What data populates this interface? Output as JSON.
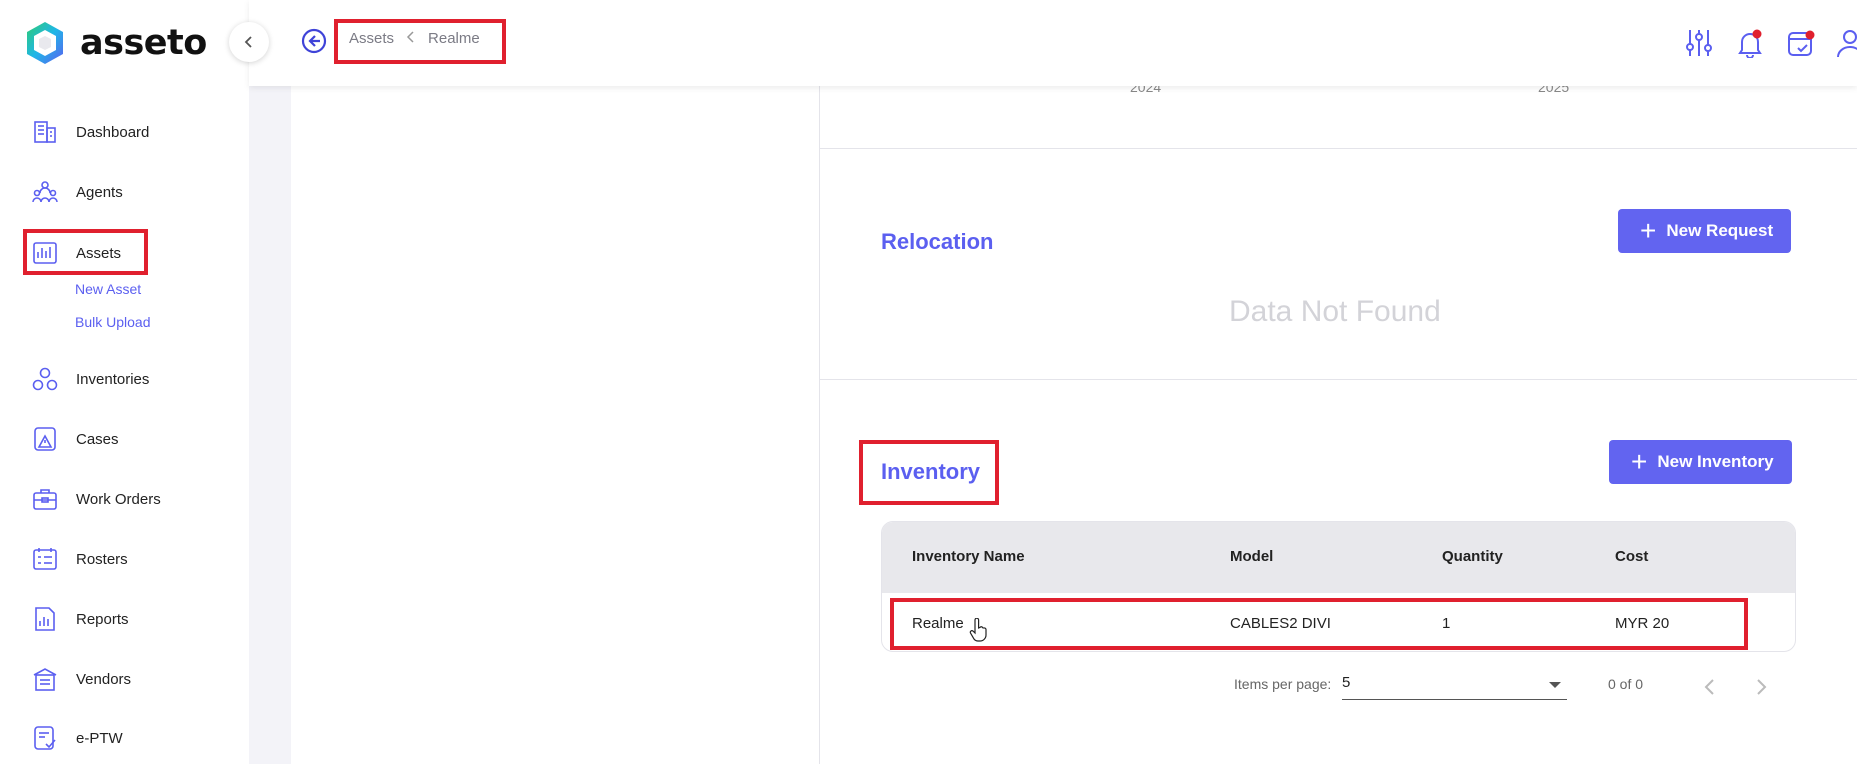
{
  "app": {
    "name": "asseto"
  },
  "breadcrumb": {
    "parent": "Assets",
    "current": "Realme"
  },
  "sidebar": {
    "items": [
      {
        "label": "Dashboard",
        "icon": "dashboard-icon"
      },
      {
        "label": "Agents",
        "icon": "agents-icon"
      },
      {
        "label": "Assets",
        "icon": "assets-icon"
      },
      {
        "label": "Inventories",
        "icon": "inventories-icon"
      },
      {
        "label": "Cases",
        "icon": "cases-icon"
      },
      {
        "label": "Work Orders",
        "icon": "work-orders-icon"
      },
      {
        "label": "Rosters",
        "icon": "rosters-icon"
      },
      {
        "label": "Reports",
        "icon": "reports-icon"
      },
      {
        "label": "Vendors",
        "icon": "vendors-icon"
      },
      {
        "label": "e-PTW",
        "icon": "eptw-icon"
      }
    ],
    "assets_sub": [
      "New Asset",
      "Bulk Upload"
    ]
  },
  "chart": {
    "years": [
      "2024",
      "2025"
    ]
  },
  "relocation": {
    "title": "Relocation",
    "button": "New Request",
    "empty": "Data Not Found"
  },
  "inventory": {
    "title": "Inventory",
    "button": "New Inventory",
    "columns": [
      "Inventory Name",
      "Model",
      "Quantity",
      "Cost"
    ],
    "rows": [
      {
        "name": "Realme",
        "model": "CABLES2 DIVI",
        "quantity": "1",
        "cost": "MYR 20"
      }
    ]
  },
  "paginator": {
    "items_label": "Items per page:",
    "page_size": "5",
    "range": "0 of 0"
  },
  "colors": {
    "accent": "#5b5ff0",
    "button": "#6264f0",
    "highlight": "#e0202e"
  }
}
